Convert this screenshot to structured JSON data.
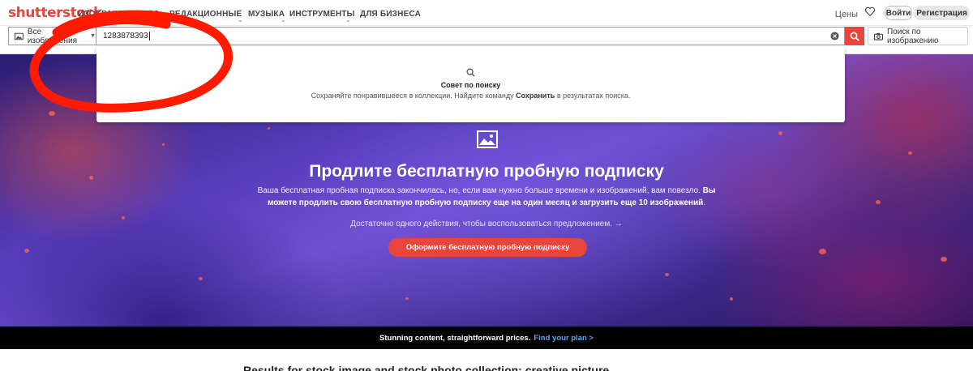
{
  "header": {
    "logo": "shutterstock",
    "nav": [
      {
        "label": "Изображения",
        "has_menu": true
      },
      {
        "label": "Видео",
        "has_menu": true
      },
      {
        "label": "Редакционные",
        "has_menu": true
      },
      {
        "label": "Музыка",
        "has_menu": true
      },
      {
        "label": "Инструменты",
        "has_menu": true
      },
      {
        "label": "Для бизнеса",
        "has_menu": false
      }
    ],
    "prices": "Цены",
    "login": "Войти",
    "register": "Регистрация"
  },
  "search": {
    "type_label": "Все изображения",
    "query": "1283878393",
    "reverse_label": "Поиск по изображению"
  },
  "suggestion": {
    "title": "Совет по поиску",
    "text_before": "Сохраняйте понравившееся в коллекции. Найдите команду",
    "text_bold": "Сохранить",
    "text_after": "в результатах поиска."
  },
  "hero": {
    "title": "Продлите бесплатную пробную подписку",
    "text_plain": "Ваша бесплатная пробная подписка закончилась, но, если вам нужно больше времени и изображений, вам повезло.",
    "text_bold": "Вы можете продлить свою бесплатную пробную подписку еще на один месяц и загрузить еще 10 изображений",
    "text_end": ".",
    "note": "Достаточно одного действия, чтобы воспользоваться предложением.",
    "cta": "Оформите бесплатную пробную подписку"
  },
  "promo": {
    "text": "Stunning content, straightforward prices.",
    "link": "Find your plan >"
  },
  "results_heading": "Results for stock image and stock photo collection: creative picture",
  "colors": {
    "brand_red": "#e8453c",
    "link_blue": "#4fa8ff",
    "annotation_red": "#ff1a00"
  }
}
